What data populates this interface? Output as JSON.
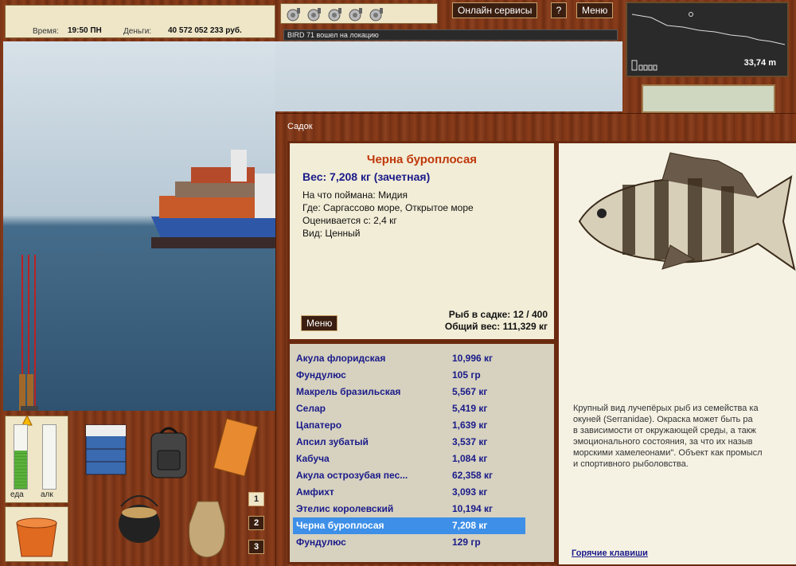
{
  "info": {
    "time_label": "Время:",
    "time_value": "19:50 ПН",
    "money_label": "Деньги:",
    "money_value": "40 572 052 233 руб."
  },
  "topbar": {
    "online_label": "Онлайн сервисы",
    "help_label": "?",
    "menu_label": "Меню"
  },
  "chat": {
    "message": "BIRD 71 вошел на локацию"
  },
  "depth": {
    "value": "33,74 m"
  },
  "meters": {
    "food_label": "еда",
    "food_level": 0.6,
    "alcohol_label": "алк",
    "alcohol_level": 0
  },
  "slots": [
    "1",
    "2",
    "3"
  ],
  "sadok": {
    "title": "Садок",
    "fish_name": "Черна буроплосая",
    "weight_line": "Вес: 7,208 кг (зачетная)",
    "details": [
      "На что поймана: Мидия",
      "Где: Саргассово море, Открытое море",
      "Оценивается с: 2,4 кг",
      "Вид: Ценный"
    ],
    "menu_label": "Меню",
    "count_line": "Рыб в садке: 12 / 400",
    "total_line": "Общий вес: 111,329 кг",
    "selected_index": 10,
    "list": [
      {
        "name": "Акула флоридская",
        "weight": "10,996 кг"
      },
      {
        "name": "Фундулюс",
        "weight": "105 гр"
      },
      {
        "name": "Макрель бразильская",
        "weight": "5,567 кг"
      },
      {
        "name": "Селар",
        "weight": "5,419 кг"
      },
      {
        "name": "Цапатеро",
        "weight": "1,639 кг"
      },
      {
        "name": "Апсил зубатый",
        "weight": "3,537 кг"
      },
      {
        "name": "Кабуча",
        "weight": "1,084 кг"
      },
      {
        "name": "Акула острозубая пес...",
        "weight": "62,358 кг"
      },
      {
        "name": "Амфихт",
        "weight": "3,093 кг"
      },
      {
        "name": "Этелис королевский",
        "weight": "10,194 кг"
      },
      {
        "name": "Черна буроплосая",
        "weight": "7,208 кг"
      },
      {
        "name": "Фундулюс",
        "weight": "129 гр"
      }
    ],
    "description": [
      "Крупный вид лучепёрых рыб из семейства ка",
      "окуней (Serranidae). Окраска может быть ра",
      "в зависимости от окружающей среды, а такж",
      "эмоционального состояния, за что их назыв",
      "морскими хамелеонами\". Объект как промысл",
      "и спортивного рыболовства."
    ],
    "hotkeys_label": "Горячие клавиши"
  },
  "colors": {
    "accent_red": "#c0390e",
    "list_blue": "#1a1a8a",
    "selection": "#3d8fe8"
  }
}
